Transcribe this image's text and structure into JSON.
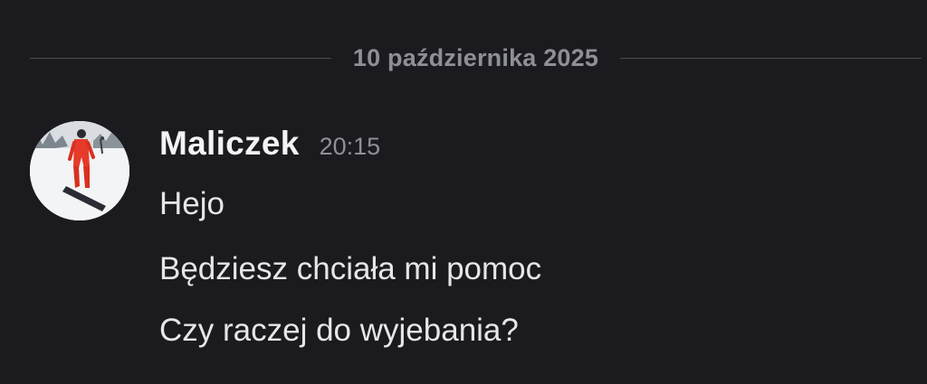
{
  "divider": {
    "date": "10 października 2025"
  },
  "message": {
    "author": "Maliczek",
    "time": "20:15",
    "avatar_icon": "user-avatar-snowboarder",
    "lines": [
      "Hejo",
      "Będziesz chciała mi pomoc",
      "Czy raczej do wyjebania?"
    ]
  },
  "colors": {
    "background": "#1b1b1f",
    "muted_text": "#8e8f97",
    "username": "#f2f3f5",
    "message_text": "#e6e6ea",
    "divider_line": "#4b4b52"
  }
}
